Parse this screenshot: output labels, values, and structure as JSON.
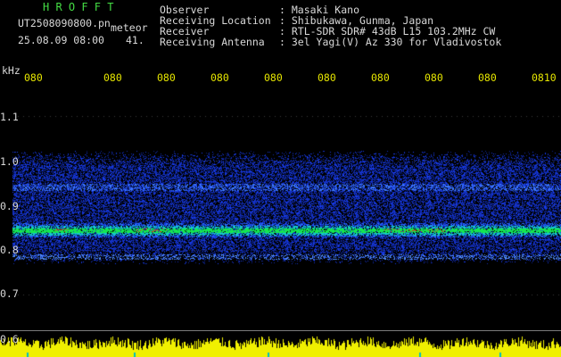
{
  "header": {
    "program": "H R O F F T",
    "filename": "UT2508090800.pn",
    "meteor_label": "meteor",
    "date": "25.08.09 08:00",
    "count": "41.",
    "observer_label": "Observer",
    "observer_value": ": Masaki Kano",
    "location_label": "Receiving Location",
    "location_value": ": Shibukawa, Gunma, Japan",
    "receiver_label": "Receiver",
    "receiver_value": ": RTL-SDR SDR# 43dB L15 103.2MHz CW",
    "antenna_label": "Receiving Antenna",
    "antenna_value": ": 3el Yagi(V) Az 330 for Vladivostok"
  },
  "axis": {
    "unit": "kHz",
    "y_ticks": [
      "1.1",
      "1.0",
      "0.9",
      "0.8",
      "0.7",
      "0.6"
    ],
    "x_ticks": [
      "080",
      "080",
      "080",
      "080",
      "080",
      "080",
      "080",
      "080",
      "080",
      "0810"
    ]
  },
  "colors": {
    "background": "#000000",
    "noise": "#1030d0",
    "signal": "#10d040",
    "strong": "#e02020",
    "power_bar": "#f0f000",
    "tick_text": "#e6e600"
  }
}
